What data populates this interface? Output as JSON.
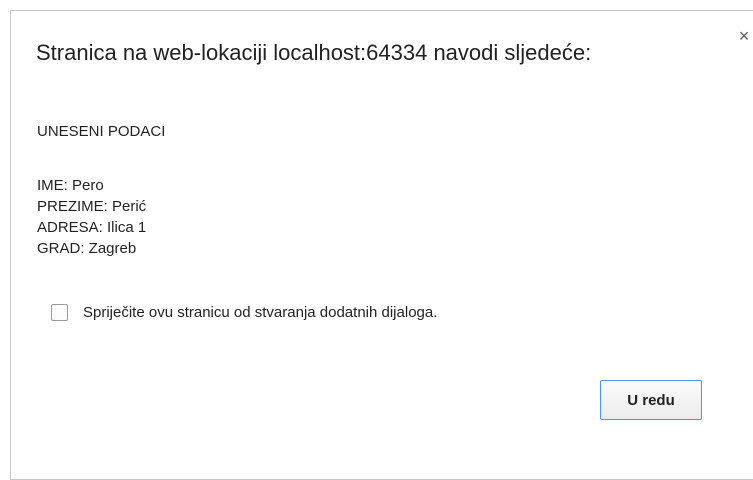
{
  "dialog": {
    "title": "Stranica na web-lokaciji localhost:64334 navodi sljedeće:",
    "close_glyph": "×",
    "message": {
      "heading": "UNESENI PODACI",
      "lines": [
        "IME: Pero",
        "PREZIME: Perić",
        "ADRESA: Ilica 1",
        "GRAD: Zagreb"
      ]
    },
    "suppress_checkbox": {
      "label": "Spriječite ovu stranicu od stvaranja dodatnih dijaloga.",
      "checked": false
    },
    "ok_button": {
      "label": "U redu"
    }
  },
  "colors": {
    "accent": "#4d90fe",
    "text": "#222222",
    "border": "#c8c8c8"
  },
  "icons": {
    "close": "close-icon"
  }
}
